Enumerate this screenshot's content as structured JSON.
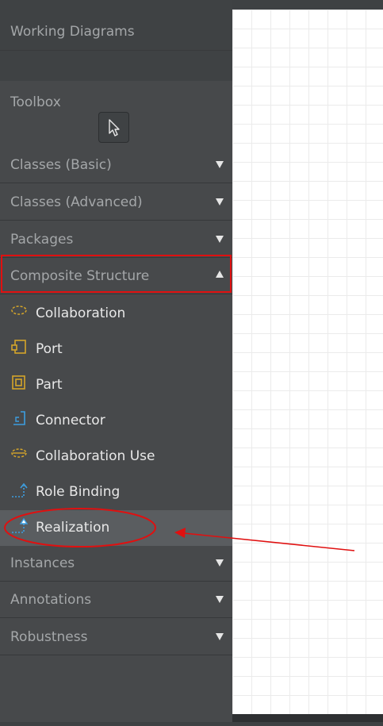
{
  "header": {
    "working_diagrams": "Working Diagrams"
  },
  "toolbox": {
    "label": "Toolbox",
    "pointer_icon": "pointer-icon"
  },
  "sections_top": [
    {
      "label": "Classes (Basic)",
      "expanded": false
    },
    {
      "label": "Classes (Advanced)",
      "expanded": false
    },
    {
      "label": "Packages",
      "expanded": false
    },
    {
      "label": "Composite Structure",
      "expanded": true
    }
  ],
  "composite_items": [
    {
      "label": "Collaboration",
      "icon": "collaboration-icon"
    },
    {
      "label": "Port",
      "icon": "port-icon"
    },
    {
      "label": "Part",
      "icon": "part-icon"
    },
    {
      "label": "Connector",
      "icon": "connector-icon"
    },
    {
      "label": "Collaboration Use",
      "icon": "collaboration-use-icon"
    },
    {
      "label": "Role Binding",
      "icon": "role-binding-icon"
    },
    {
      "label": "Realization",
      "icon": "realization-icon",
      "selected": true
    }
  ],
  "sections_bottom": [
    {
      "label": "Instances",
      "expanded": false
    },
    {
      "label": "Annotations",
      "expanded": false
    },
    {
      "label": "Robustness",
      "expanded": false
    }
  ],
  "colors": {
    "sidebar_bg": "#47494b",
    "highlight_red": "#e01010",
    "icon_gold": "#d4a52a",
    "icon_blue": "#3d9ee0",
    "selected_bg": "#5a5d60"
  }
}
